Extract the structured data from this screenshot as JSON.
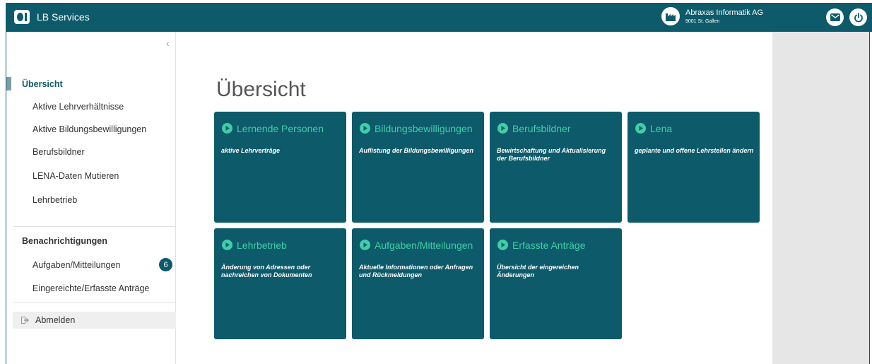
{
  "header": {
    "brand_name": "LB Services",
    "org_name": "Abraxas Informatik AG",
    "org_place": "9001 St. Gallen"
  },
  "sidebar": {
    "collapse_label": "‹",
    "main_items": [
      {
        "label": "Übersicht",
        "active": true
      },
      {
        "label": "Aktive Lehrverhältnisse"
      },
      {
        "label": "Aktive Bildungsbewilligungen"
      },
      {
        "label": "Berufsbildner"
      },
      {
        "label": "LENA-Daten Mutieren"
      },
      {
        "label": "Lehrbetrieb"
      }
    ],
    "notifications_title": "Benachrichtigungen",
    "notification_items": [
      {
        "label": "Aufgaben/Mitteilungen",
        "badge": "6"
      },
      {
        "label": "Eingereichte/Erfasste Anträge"
      }
    ],
    "logout_label": "Abmelden"
  },
  "main": {
    "title": "Übersicht",
    "tiles": [
      {
        "title": "Lernende Personen",
        "desc": "aktive Lehrverträge"
      },
      {
        "title": "Bildungsbewilligungen",
        "desc": "Auflistung der Bildungsbewilligungen"
      },
      {
        "title": "Berufsbildner",
        "desc": "Bewirtschaftung und Aktualisierung der Berufsbildner"
      },
      {
        "title": "Lena",
        "desc": "geplante und offene Lehrstellen ändern"
      },
      {
        "title": "Lehrbetrieb",
        "desc": "Änderung von Adressen oder nachreichen von Dokumenten"
      },
      {
        "title": "Aufgaben/Mitteilungen",
        "desc": "Aktuelle Informationen oder Anfragen und Rückmeldungen"
      },
      {
        "title": "Erfasste Anträge",
        "desc": "Übersicht der eingereichen Änderungen"
      }
    ]
  },
  "colors": {
    "primary": "#0d5a6b",
    "accent": "#3fcfa8",
    "panel_gray": "#e6e6e6"
  }
}
